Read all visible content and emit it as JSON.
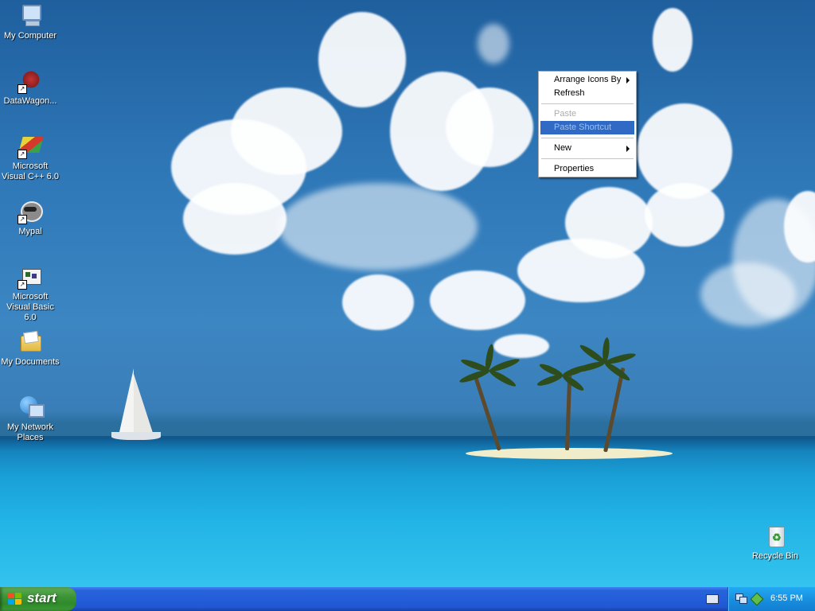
{
  "desktop": {
    "icons": [
      {
        "label": "My Computer",
        "icon": "computer-icon"
      },
      {
        "label": "DataWagon...",
        "icon": "datawagon-icon"
      },
      {
        "label": "Microsoft Visual C++ 6.0",
        "icon": "visual-cpp-icon"
      },
      {
        "label": "Mypal",
        "icon": "mypal-icon"
      },
      {
        "label": "Microsoft Visual Basic 6.0",
        "icon": "visual-basic-icon"
      },
      {
        "label": "My Documents",
        "icon": "folder-icon"
      },
      {
        "label": "My Network Places",
        "icon": "network-icon"
      }
    ],
    "recycle_bin": {
      "label": "Recycle Bin",
      "icon": "recycle-bin-icon"
    }
  },
  "context_menu": {
    "items": [
      {
        "label": "Arrange Icons By",
        "submenu": true,
        "enabled": true
      },
      {
        "label": "Refresh",
        "enabled": true
      },
      {
        "label": "Paste",
        "enabled": false
      },
      {
        "label": "Paste Shortcut",
        "enabled": false,
        "highlighted": true
      },
      {
        "label": "New",
        "submenu": true,
        "enabled": true
      },
      {
        "label": "Properties",
        "enabled": true
      }
    ]
  },
  "taskbar": {
    "start_label": "start",
    "clock": "6:55 PM",
    "tray_icons": [
      "keyboard-icon",
      "network-tray-icon",
      "safely-remove-icon"
    ]
  },
  "colors": {
    "taskbar_blue": "#245edb",
    "start_green": "#3c9437",
    "menu_highlight": "#316ac5"
  }
}
